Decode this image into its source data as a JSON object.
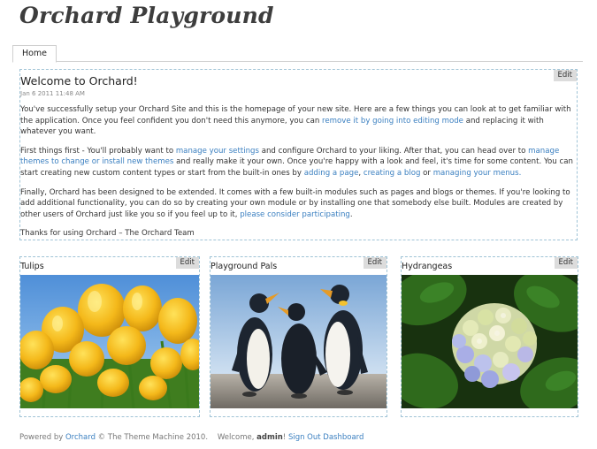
{
  "site": {
    "title": "Orchard Playground"
  },
  "menu": {
    "items": [
      {
        "label": "Home"
      }
    ]
  },
  "edit_label": "Edit",
  "welcome": {
    "title": "Welcome to Orchard!",
    "date": "Jan 6 2011 11:48 AM",
    "p1": {
      "a": "You've successfully setup your Orchard Site and this is the homepage of your new site. Here are a few things you can look at to get familiar with the application. Once you feel confident you don't need this anymore, you can ",
      "link1": "remove it by going into editing mode",
      "b": " and replacing it with whatever you want."
    },
    "p2": {
      "a": "First things first - You'll probably want to ",
      "link1": "manage your settings",
      "b": " and configure Orchard to your liking. After that, you can head over to ",
      "link2": "manage themes to change or install new themes",
      "c": " and really make it your own. Once you're happy with a look and feel, it's time for some content. You can start creating new custom content types or start from the built-in ones by ",
      "link3": "adding a page",
      "d": ", ",
      "link4": "creating a blog",
      "e": " or ",
      "link5": "managing your menus.",
      "f": ""
    },
    "p3": {
      "a": "Finally, Orchard has been designed to be extended. It comes with a few built-in modules such as pages and blogs or themes. If you're looking to add additional functionality, you can do so by creating your own module or by installing one that somebody else built. Modules are created by other users of Orchard just like you so if you feel up to it, ",
      "link1": "please consider participating",
      "b": "."
    },
    "p4": "Thanks for using Orchard – The Orchard Team"
  },
  "cards": [
    {
      "title": "Tulips",
      "image": "tulips-photo"
    },
    {
      "title": "Playground Pals",
      "image": "penguins-photo"
    },
    {
      "title": "Hydrangeas",
      "image": "hydrangeas-photo"
    }
  ],
  "footer": {
    "powered_by": "Powered by ",
    "orchard_link": "Orchard",
    "copyright": " © The Theme Machine 2010.",
    "welcome_text": "Welcome, ",
    "user": "admin",
    "excl": "!",
    "sign_out": "Sign Out",
    "dashboard": "Dashboard"
  },
  "colors": {
    "link": "#3a7fc0",
    "zone_border": "#9fc3d6",
    "edit_bg": "#dcdcdc"
  }
}
